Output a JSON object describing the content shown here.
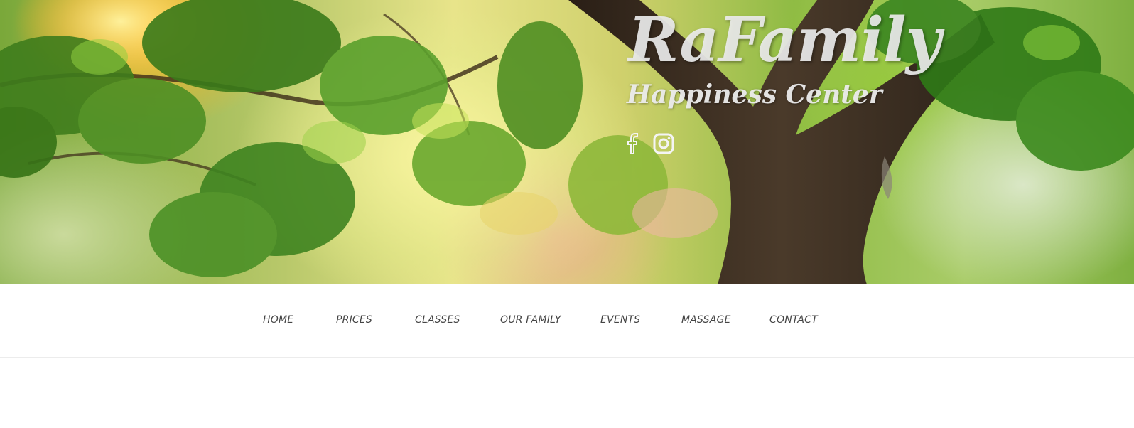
{
  "site": {
    "title": "RaFamily",
    "subtitle": "Happiness Center"
  },
  "social": [
    {
      "name": "facebook-icon"
    },
    {
      "name": "instagram-icon"
    }
  ],
  "nav": {
    "items": [
      {
        "label": "HOME"
      },
      {
        "label": "PRICES"
      },
      {
        "label": "CLASSES"
      },
      {
        "label": "OUR FAMILY"
      },
      {
        "label": "EVENTS"
      },
      {
        "label": "MASSAGE"
      },
      {
        "label": "CONTACT"
      }
    ]
  },
  "colors": {
    "nav_text": "#444444",
    "title_text": "#ececec",
    "nav_background": "#ffffff"
  }
}
